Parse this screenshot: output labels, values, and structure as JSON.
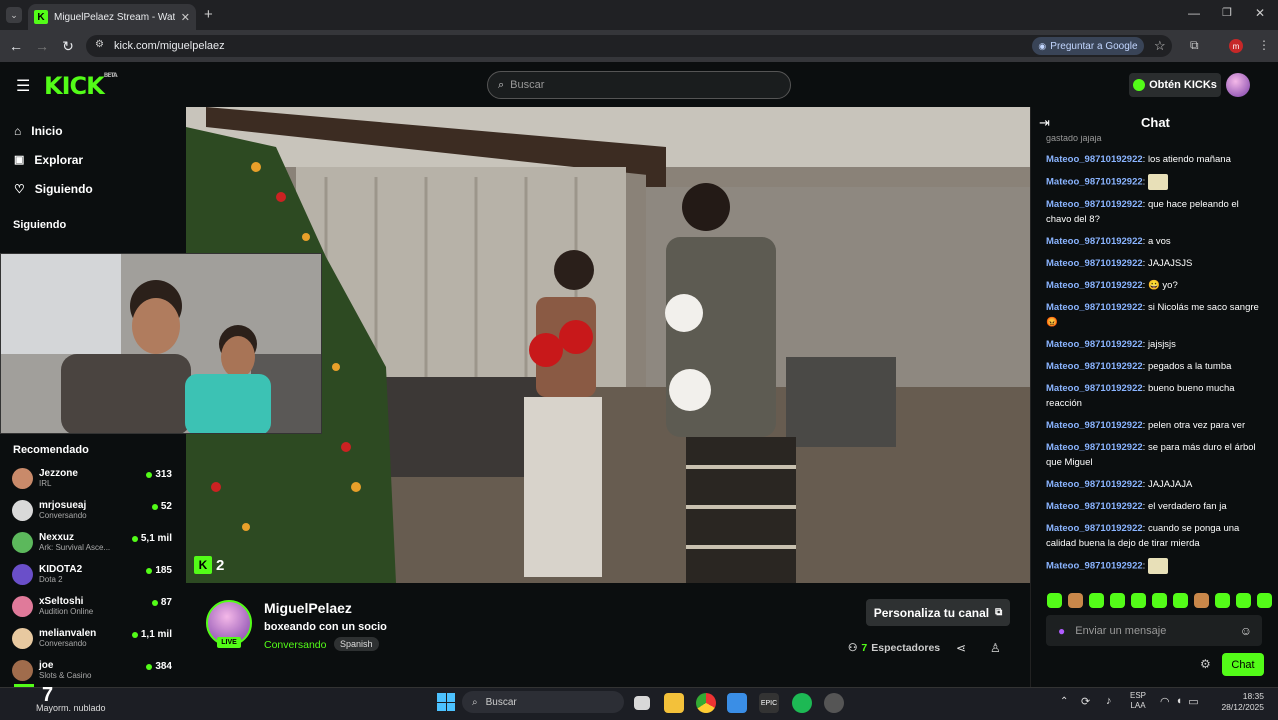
{
  "browser": {
    "tab_title": "MiguelPelaez Stream - Watch L",
    "url": "kick.com/miguelpelaez",
    "google_pill": "Preguntar a Google"
  },
  "header": {
    "logo": "KICK",
    "logo_tag": "BETA",
    "search_placeholder": "Buscar",
    "kicks_button": "Obtén KICKs"
  },
  "sidebar": {
    "nav": [
      {
        "label": "Inicio",
        "icon": "home-icon"
      },
      {
        "label": "Explorar",
        "icon": "compass-icon"
      },
      {
        "label": "Siguiendo",
        "icon": "heart-icon"
      }
    ],
    "following_title": "Siguiendo",
    "recommended_title": "Recomendado",
    "channels": [
      {
        "name": "Jezzone",
        "category": "IRL",
        "viewers": "313",
        "color": "#c98a6a"
      },
      {
        "name": "mrjosueaj",
        "category": "Conversando",
        "viewers": "52",
        "color": "#d9d9d9"
      },
      {
        "name": "Nexxuz",
        "category": "Ark: Survival Asce...",
        "viewers": "5,1 mil",
        "color": "#5cb85c"
      },
      {
        "name": "KIDOTA2",
        "category": "Dota 2",
        "viewers": "185",
        "color": "#6a4fc9"
      },
      {
        "name": "xSeltoshi",
        "category": "Audition Online",
        "viewers": "87",
        "color": "#e07a9a"
      },
      {
        "name": "melianvalen",
        "category": "Conversando",
        "viewers": "1,1 mil",
        "color": "#e8c9a0"
      },
      {
        "name": "joe",
        "category": "Slots & Casino",
        "viewers": "384",
        "color": "#a06c4c"
      }
    ]
  },
  "video": {
    "overlay_count": "2",
    "corner_count": "7",
    "weather_text": "Mayorm. nublado"
  },
  "stream": {
    "channel": "MiguelPelaez",
    "title": "boxeando con un socio",
    "category": "Conversando",
    "language": "Spanish",
    "live_badge": "LIVE",
    "customize_button": "Personaliza tu canal",
    "viewers": "7",
    "viewers_label": "Espectadores"
  },
  "chat": {
    "title": "Chat",
    "top_fragment": "gastado jajaja",
    "messages": [
      {
        "user": "Mateoo_98710192922",
        "text": "los atiendo mañana"
      },
      {
        "user": "Mateoo_98710192922",
        "text": "",
        "emote": true
      },
      {
        "user": "Mateoo_98710192922",
        "text": "que hace peleando el chavo del 8?"
      },
      {
        "user": "Mateoo_98710192922",
        "text": "a vos"
      },
      {
        "user": "Mateoo_98710192922",
        "text": "JAJAJSJS"
      },
      {
        "user": "Mateoo_98710192922",
        "text": "😀 yo?"
      },
      {
        "user": "Mateoo_98710192922",
        "text": "si Nicolás me saco sangre 😡"
      },
      {
        "user": "Mateoo_98710192922",
        "text": "jajsjsjs"
      },
      {
        "user": "Mateoo_98710192922",
        "text": "pegados a la tumba"
      },
      {
        "user": "Mateoo_98710192922",
        "text": "bueno bueno mucha reacción"
      },
      {
        "user": "Mateoo_98710192922",
        "text": "pelen otra vez para ver"
      },
      {
        "user": "Mateoo_98710192922",
        "text": "se para más duro el árbol que Miguel"
      },
      {
        "user": "Mateoo_98710192922",
        "text": "JAJAJAJA"
      },
      {
        "user": "Mateoo_98710192922",
        "text": "el verdadero fan ja"
      },
      {
        "user": "Mateoo_98710192922",
        "text": "cuando se ponga una calidad buena la dejo de tirar mierda"
      },
      {
        "user": "Mateoo_98710192922",
        "text": "",
        "emote": true
      }
    ],
    "input_placeholder": "Enviar un mensaje",
    "send_button": "Chat"
  },
  "taskbar": {
    "search_label": "Buscar",
    "lang_top": "ESP",
    "lang_bottom": "LAA",
    "time": "18:35",
    "date": "28/12/2025"
  },
  "colors": {
    "accent": "#53fc18",
    "username": "#8ab4ff",
    "background": "#0b0e0f"
  }
}
